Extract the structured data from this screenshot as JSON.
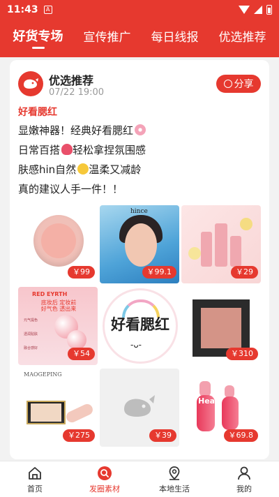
{
  "status_bar": {
    "time": "11:43",
    "app_icon_letter": "A"
  },
  "tabs": [
    {
      "label": "好货专场",
      "active": true
    },
    {
      "label": "宣传推广",
      "active": false
    },
    {
      "label": "每日线报",
      "active": false
    },
    {
      "label": "优选推荐",
      "active": false
    }
  ],
  "post": {
    "author": "优选推荐",
    "date": "07/22 19:00",
    "share_label": "分享",
    "tag": "好看腮红",
    "lines": [
      "显嫩神器！经典好看腮红",
      "日常百搭",
      "轻松拿捏氛围感",
      "肤感hin自然",
      "温柔又减龄",
      "真的建议人手一件！！"
    ],
    "emoji": {
      "flower": "cherry-blossom",
      "heart": "sparkling-heart",
      "smile": "smiling-face"
    }
  },
  "grid": {
    "items": [
      {
        "price": "￥99"
      },
      {
        "price": "￥99.1",
        "brand": "hince"
      },
      {
        "price": "￥29"
      },
      {
        "price": "￥54",
        "brand": "RED EYRTH",
        "headline": "底妆后 定妆前 好气色 透出来",
        "features": [
          "元气提色",
          "透润贴肤",
          "融合感好"
        ]
      },
      {
        "badge_text": "好看腮红",
        "face": "-ᴗ-"
      },
      {
        "price": "￥310"
      },
      {
        "price": "￥275",
        "brand": "MAOGEPING"
      },
      {
        "price": "￥39"
      },
      {
        "price": "￥69.8",
        "brand": "Heau"
      }
    ]
  },
  "bottom_nav": [
    {
      "label": "首页",
      "icon": "home-icon",
      "active": false
    },
    {
      "label": "发圈素材",
      "icon": "search-icon",
      "active": true
    },
    {
      "label": "本地生活",
      "icon": "location-pin-icon",
      "active": false
    },
    {
      "label": "我的",
      "icon": "person-icon",
      "active": false
    }
  ],
  "colors": {
    "brand": "#e6392f",
    "background": "#f2f2f2"
  }
}
